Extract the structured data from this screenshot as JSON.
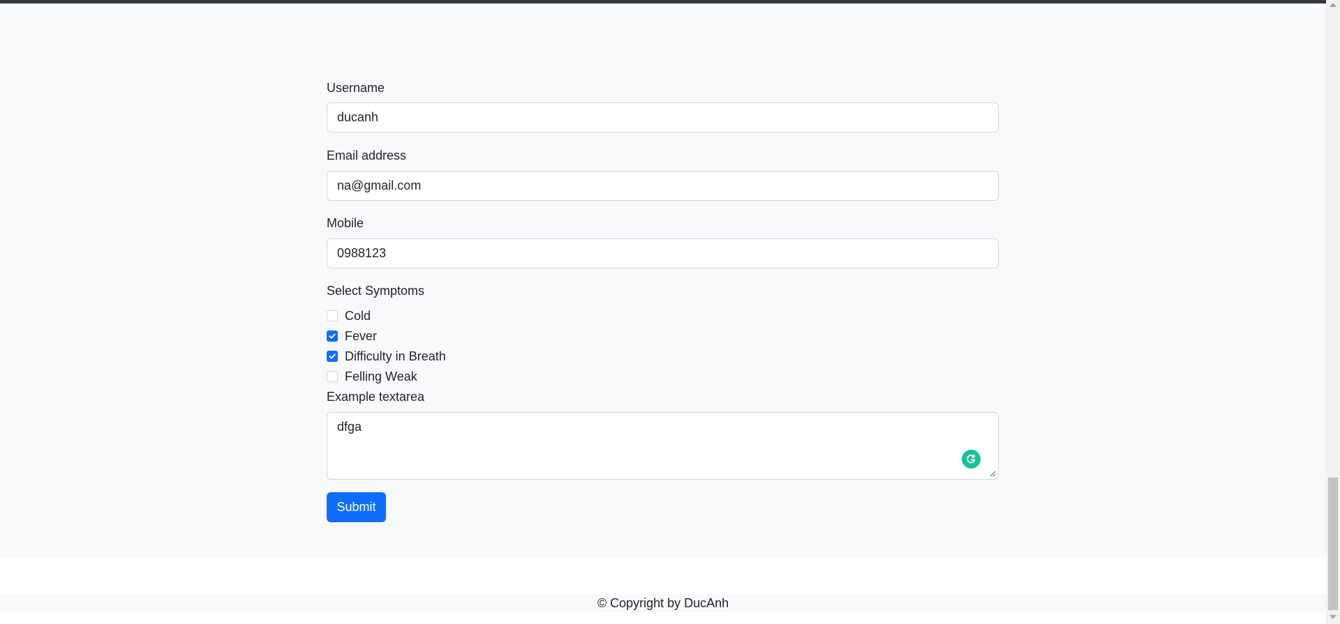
{
  "form": {
    "username": {
      "label": "Username",
      "value": "ducanh"
    },
    "email": {
      "label": "Email address",
      "value": "na@gmail.com"
    },
    "mobile": {
      "label": "Mobile",
      "value": "0988123"
    },
    "symptoms": {
      "label": "Select Symptoms",
      "options": [
        {
          "label": "Cold",
          "checked": false
        },
        {
          "label": "Fever",
          "checked": true
        },
        {
          "label": "Difficulty in Breath",
          "checked": true
        },
        {
          "label": "Felling Weak",
          "checked": false
        }
      ]
    },
    "textarea": {
      "label": "Example textarea",
      "value": "dfga"
    },
    "submit_label": "Submit"
  },
  "footer": {
    "text": "© Copyright by DucAnh"
  },
  "colors": {
    "primary": "#0d6efd",
    "page_bg": "#f8f9fa",
    "top_bar": "#343a40",
    "grammarly": "#15c39a"
  },
  "icons": {
    "checkbox_mark": "check-icon",
    "grammarly": "grammarly-icon",
    "resize": "resize-handle-icon"
  }
}
